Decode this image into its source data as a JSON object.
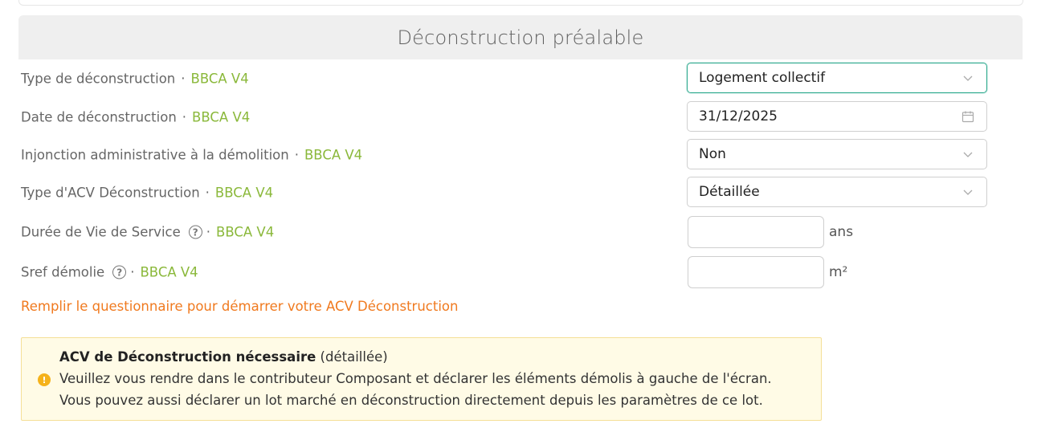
{
  "section": {
    "title": "Déconstruction préalable"
  },
  "tag": "BBCA V4",
  "separator": "·",
  "rows": {
    "type_deconstruction": {
      "label": "Type de déconstruction",
      "value": "Logement collectif"
    },
    "date_deconstruction": {
      "label": "Date de déconstruction",
      "value": "31/12/2025"
    },
    "injonction": {
      "label": "Injonction administrative à la démolition",
      "value": "Non"
    },
    "type_acv": {
      "label": "Type d'ACV Déconstruction",
      "value": "Détaillée"
    },
    "duree_vie": {
      "label": "Durée de Vie de Service",
      "value": "",
      "unit": "ans"
    },
    "sref": {
      "label": "Sref démolie",
      "value": "",
      "unit": "m²"
    }
  },
  "help_glyph": "?",
  "cta": "Remplir le questionnaire pour démarrer votre ACV Déconstruction",
  "alert": {
    "title_strong": "ACV de Déconstruction nécessaire",
    "title_rest": " (détaillée)",
    "line1": "Veuillez vous rendre dans le contributeur Composant et déclarer les éléments démolis à gauche de l'écran.",
    "line2": "Vous pouvez aussi déclarer un lot marché en déconstruction directement depuis les paramètres de ce lot.",
    "icon_glyph": "!"
  },
  "colors": {
    "tag": "#8ab83a",
    "cta": "#f07a1f",
    "focus": "#2aa88c",
    "alert_bg": "#fffbe6",
    "alert_icon": "#f5b21b"
  }
}
